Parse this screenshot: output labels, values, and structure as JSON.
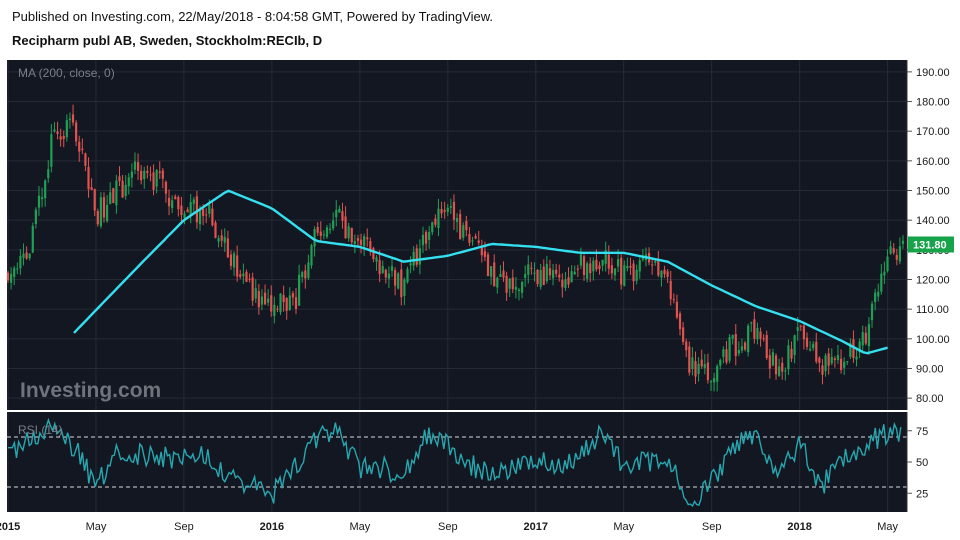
{
  "header": {
    "published": "Published on Investing.com, 22/May/2018 - 8:04:58 GMT, Powered by TradingView.",
    "instrument": "Recipharm publ AB, Sweden, Stockholm:RECIb, D"
  },
  "colors": {
    "background": "#131722",
    "grid": "#262a35",
    "candle_up": "#1fa055",
    "candle_down": "#e0534f",
    "ma_line": "#34e0f0",
    "rsi_line": "#27a7b0",
    "price_badge": "#16a34a",
    "axis_text": "#1a1a1a",
    "overlay_text": "#7b7f88"
  },
  "chart_data": [
    {
      "type": "candlestick",
      "indicator_label": "MA (200, close, 0)",
      "watermark": "Investing.com",
      "last_price_label": "131.80",
      "y_ticks": [
        "190.00",
        "180.00",
        "170.00",
        "160.00",
        "150.00",
        "140.00",
        "130.00",
        "120.00",
        "110.00",
        "100.00",
        "90.00",
        "80.00"
      ],
      "ylim": [
        76,
        194
      ],
      "x_ticks": [
        "2015",
        "May",
        "Sep",
        "2016",
        "May",
        "Sep",
        "2017",
        "May",
        "Sep",
        "2018",
        "May"
      ],
      "x_tick_dates": [
        "2015-01",
        "2015-05",
        "2015-09",
        "2016-01",
        "2016-05",
        "2016-09",
        "2017-01",
        "2017-05",
        "2017-09",
        "2018-01",
        "2018-05"
      ],
      "price_path": [
        {
          "date": "2015-01",
          "close": 122
        },
        {
          "date": "2015-02",
          "close": 130
        },
        {
          "date": "2015-03",
          "close": 168
        },
        {
          "date": "2015-04",
          "close": 172
        },
        {
          "date": "2015-05",
          "close": 142
        },
        {
          "date": "2015-06",
          "close": 150
        },
        {
          "date": "2015-07",
          "close": 158
        },
        {
          "date": "2015-08",
          "close": 152
        },
        {
          "date": "2015-09",
          "close": 142
        },
        {
          "date": "2015-10",
          "close": 145
        },
        {
          "date": "2015-11",
          "close": 128
        },
        {
          "date": "2015-12",
          "close": 118
        },
        {
          "date": "2016-01",
          "close": 110
        },
        {
          "date": "2016-02",
          "close": 112
        },
        {
          "date": "2016-03",
          "close": 136
        },
        {
          "date": "2016-04",
          "close": 140
        },
        {
          "date": "2016-05",
          "close": 133
        },
        {
          "date": "2016-06",
          "close": 122
        },
        {
          "date": "2016-07",
          "close": 118
        },
        {
          "date": "2016-08",
          "close": 136
        },
        {
          "date": "2016-09",
          "close": 143
        },
        {
          "date": "2016-10",
          "close": 132
        },
        {
          "date": "2016-11",
          "close": 122
        },
        {
          "date": "2016-12",
          "close": 118
        },
        {
          "date": "2017-01",
          "close": 122
        },
        {
          "date": "2017-02",
          "close": 120
        },
        {
          "date": "2017-03",
          "close": 124
        },
        {
          "date": "2017-04",
          "close": 128
        },
        {
          "date": "2017-05",
          "close": 122
        },
        {
          "date": "2017-06",
          "close": 124
        },
        {
          "date": "2017-07",
          "close": 120
        },
        {
          "date": "2017-08",
          "close": 92
        },
        {
          "date": "2017-09",
          "close": 88
        },
        {
          "date": "2017-10",
          "close": 98
        },
        {
          "date": "2017-11",
          "close": 103
        },
        {
          "date": "2017-12",
          "close": 89
        },
        {
          "date": "2018-01",
          "close": 102
        },
        {
          "date": "2018-02",
          "close": 90
        },
        {
          "date": "2018-03",
          "close": 93
        },
        {
          "date": "2018-04",
          "close": 101
        },
        {
          "date": "2018-05",
          "close": 130
        }
      ],
      "ma_200_path": [
        {
          "date": "2015-04",
          "value": 102
        },
        {
          "date": "2015-07",
          "value": 125
        },
        {
          "date": "2015-09",
          "value": 140
        },
        {
          "date": "2015-11",
          "value": 150
        },
        {
          "date": "2016-01",
          "value": 144
        },
        {
          "date": "2016-03",
          "value": 133
        },
        {
          "date": "2016-05",
          "value": 131
        },
        {
          "date": "2016-07",
          "value": 126
        },
        {
          "date": "2016-09",
          "value": 128
        },
        {
          "date": "2016-11",
          "value": 132
        },
        {
          "date": "2017-01",
          "value": 131
        },
        {
          "date": "2017-03",
          "value": 129
        },
        {
          "date": "2017-05",
          "value": 129
        },
        {
          "date": "2017-07",
          "value": 126
        },
        {
          "date": "2017-09",
          "value": 118
        },
        {
          "date": "2017-11",
          "value": 111
        },
        {
          "date": "2018-01",
          "value": 106
        },
        {
          "date": "2018-03",
          "value": 99
        },
        {
          "date": "2018-04",
          "value": 95
        },
        {
          "date": "2018-05",
          "value": 97
        }
      ]
    },
    {
      "type": "line",
      "indicator_label": "RSI (14)",
      "y_ticks": [
        "75",
        "50",
        "25"
      ],
      "ylim": [
        10,
        90
      ],
      "reference_lines": [
        70,
        30
      ],
      "rsi_path": [
        {
          "date": "2015-01",
          "value": 58
        },
        {
          "date": "2015-03",
          "value": 80
        },
        {
          "date": "2015-04",
          "value": 62
        },
        {
          "date": "2015-05",
          "value": 32
        },
        {
          "date": "2015-06",
          "value": 58
        },
        {
          "date": "2015-07",
          "value": 56
        },
        {
          "date": "2015-09",
          "value": 52
        },
        {
          "date": "2015-10",
          "value": 55
        },
        {
          "date": "2015-11",
          "value": 40
        },
        {
          "date": "2016-01",
          "value": 24
        },
        {
          "date": "2016-02",
          "value": 45
        },
        {
          "date": "2016-03",
          "value": 68
        },
        {
          "date": "2016-04",
          "value": 76
        },
        {
          "date": "2016-05",
          "value": 44
        },
        {
          "date": "2016-06",
          "value": 46
        },
        {
          "date": "2016-07",
          "value": 38
        },
        {
          "date": "2016-08",
          "value": 70
        },
        {
          "date": "2016-09",
          "value": 64
        },
        {
          "date": "2016-10",
          "value": 48
        },
        {
          "date": "2016-11",
          "value": 40
        },
        {
          "date": "2016-12",
          "value": 44
        },
        {
          "date": "2017-01",
          "value": 52
        },
        {
          "date": "2017-02",
          "value": 47
        },
        {
          "date": "2017-03",
          "value": 55
        },
        {
          "date": "2017-04",
          "value": 72
        },
        {
          "date": "2017-05",
          "value": 48
        },
        {
          "date": "2017-06",
          "value": 50
        },
        {
          "date": "2017-07",
          "value": 55
        },
        {
          "date": "2017-08",
          "value": 16
        },
        {
          "date": "2017-09",
          "value": 34
        },
        {
          "date": "2017-10",
          "value": 62
        },
        {
          "date": "2017-11",
          "value": 74
        },
        {
          "date": "2017-12",
          "value": 40
        },
        {
          "date": "2018-01",
          "value": 64
        },
        {
          "date": "2018-02",
          "value": 30
        },
        {
          "date": "2018-03",
          "value": 54
        },
        {
          "date": "2018-04",
          "value": 64
        },
        {
          "date": "2018-05",
          "value": 74
        }
      ]
    }
  ]
}
